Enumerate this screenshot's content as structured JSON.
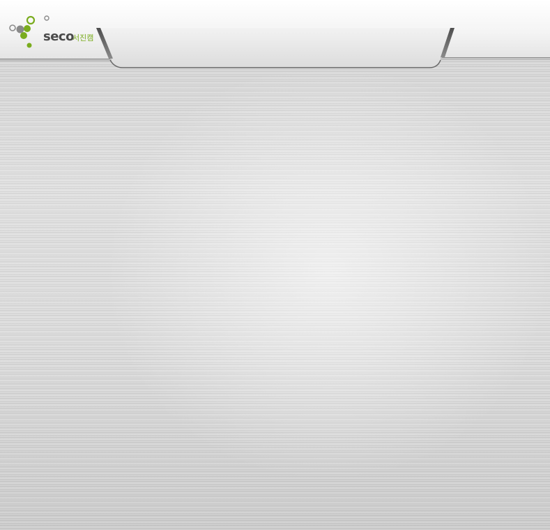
{
  "header": {
    "logo": {
      "wordmark": "seco",
      "subtitle": "서진캠",
      "accent_color": "#7aac1e",
      "text_color": "#4a4a4a",
      "icon": "molecule-dots-logo-icon"
    }
  },
  "background": {
    "style": "brushed-metal",
    "base_color": "#d8d8d8"
  }
}
